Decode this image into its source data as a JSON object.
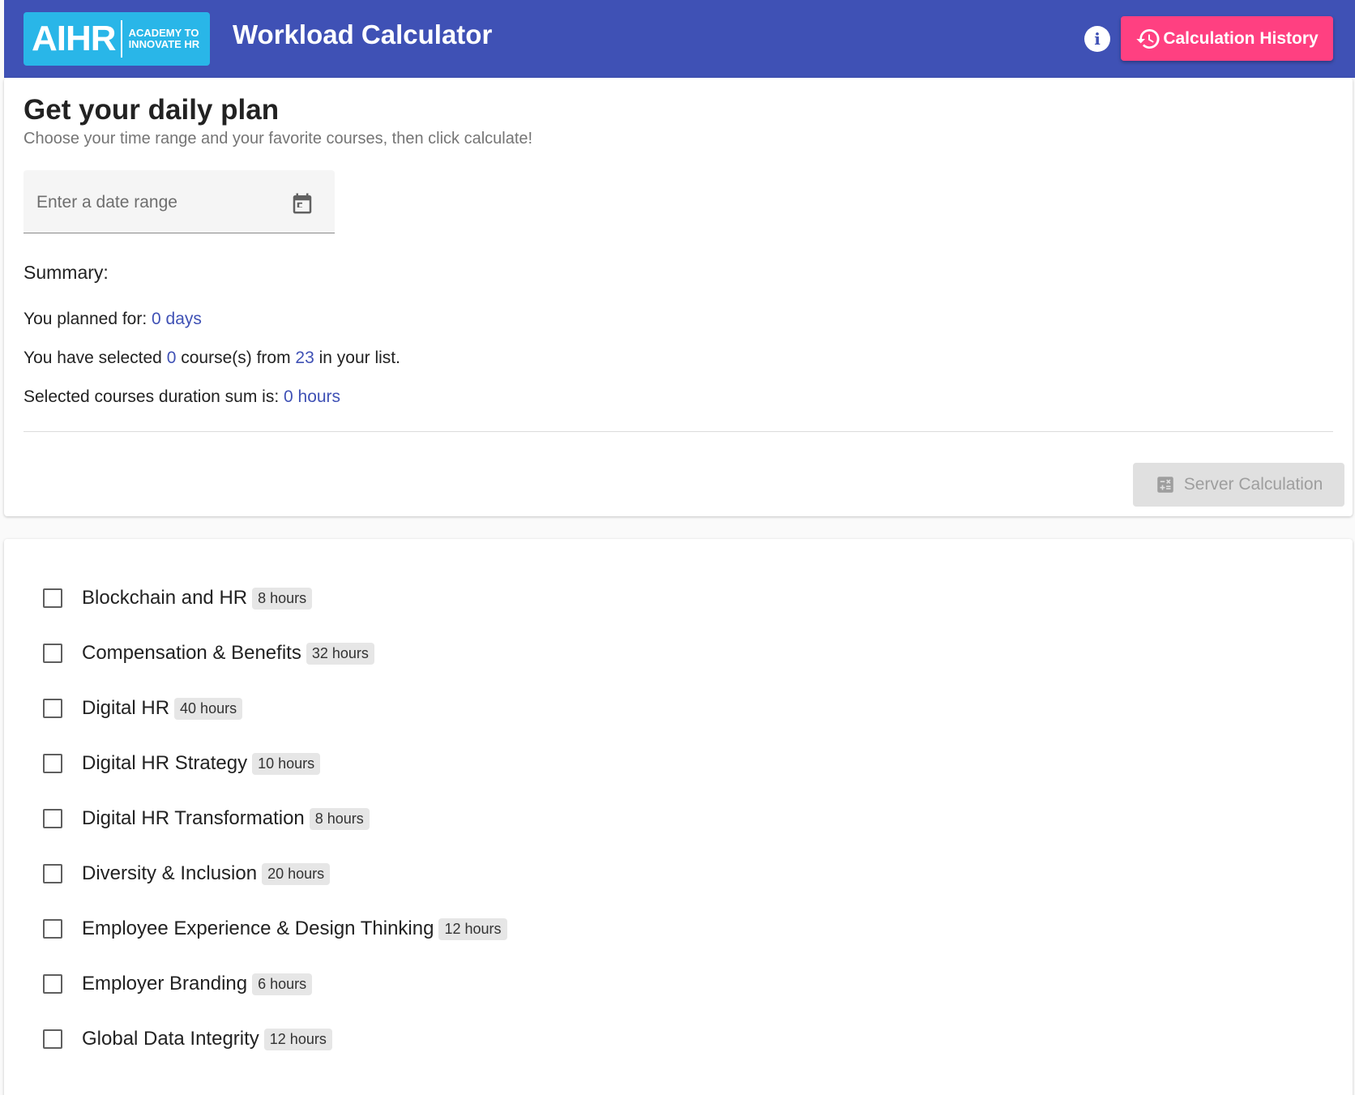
{
  "header": {
    "logo_main": "AIHR",
    "logo_sub_line1": "ACADEMY TO",
    "logo_sub_line2": "INNOVATE HR",
    "title": "Workload Calculator",
    "history_button": "Calculation History",
    "accent_color": "#ff4081",
    "brand_color": "#3f51b5"
  },
  "plan": {
    "title": "Get your daily plan",
    "subtitle": "Choose your time range and your favorite courses, then click calculate!",
    "date_placeholder": "Enter a date range",
    "summary_heading": "Summary:",
    "planned_prefix": "You planned for: ",
    "planned_value": "0 days",
    "selected_prefix": "You have selected ",
    "selected_count": "0",
    "selected_middle": " course(s) from ",
    "total_courses": "23",
    "selected_suffix": " in your list.",
    "duration_prefix": "Selected courses duration sum is: ",
    "duration_value": "0 hours",
    "server_button": "Server Calculation"
  },
  "courses": [
    {
      "name": "Blockchain and HR",
      "hours": "8 hours",
      "checked": false
    },
    {
      "name": "Compensation & Benefits",
      "hours": "32 hours",
      "checked": false
    },
    {
      "name": "Digital HR",
      "hours": "40 hours",
      "checked": false
    },
    {
      "name": "Digital HR Strategy",
      "hours": "10 hours",
      "checked": false
    },
    {
      "name": "Digital HR Transformation",
      "hours": "8 hours",
      "checked": false
    },
    {
      "name": "Diversity & Inclusion",
      "hours": "20 hours",
      "checked": false
    },
    {
      "name": "Employee Experience & Design Thinking",
      "hours": "12 hours",
      "checked": false
    },
    {
      "name": "Employer Branding",
      "hours": "6 hours",
      "checked": false
    },
    {
      "name": "Global Data Integrity",
      "hours": "12 hours",
      "checked": false
    }
  ]
}
